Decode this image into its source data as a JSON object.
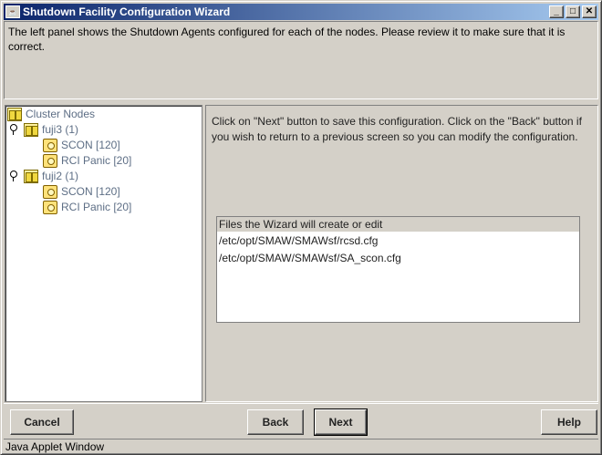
{
  "window": {
    "title": "Shutdown Facility Configuration Wizard",
    "app_icon": "java-applet-icon",
    "controls": {
      "minimize": "_",
      "maximize": "□",
      "close": "✕"
    }
  },
  "intro": {
    "text": "The left panel shows the Shutdown Agents configured for each of the nodes. Please review it to make sure that it is correct."
  },
  "tree": {
    "root": {
      "label": "Cluster Nodes",
      "icon": "folder-icon"
    },
    "nodes": [
      {
        "label": "fuji3 (1)",
        "icon": "folder-icon",
        "toggle": "expanded",
        "agents": [
          {
            "label": "SCON [120]",
            "icon": "agent-icon"
          },
          {
            "label": "RCI Panic [20]",
            "icon": "agent-icon"
          }
        ]
      },
      {
        "label": "fuji2 (1)",
        "icon": "folder-icon",
        "toggle": "expanded",
        "agents": [
          {
            "label": "SCON [120]",
            "icon": "agent-icon"
          },
          {
            "label": "RCI Panic [20]",
            "icon": "agent-icon"
          }
        ]
      }
    ]
  },
  "main": {
    "instructions": "Click on \"Next\" button to save this configuration. Click on the \"Back\" button if you wish to return to a previous screen so you can modify the configuration.",
    "files": {
      "header": "Files the Wizard will create or edit",
      "items": [
        "/etc/opt/SMAW/SMAWsf/rcsd.cfg",
        "/etc/opt/SMAW/SMAWsf/SA_scon.cfg"
      ]
    }
  },
  "buttons": {
    "cancel": "Cancel",
    "back": "Back",
    "next": "Next",
    "help": "Help"
  },
  "statusbar": {
    "text": "Java Applet Window"
  }
}
